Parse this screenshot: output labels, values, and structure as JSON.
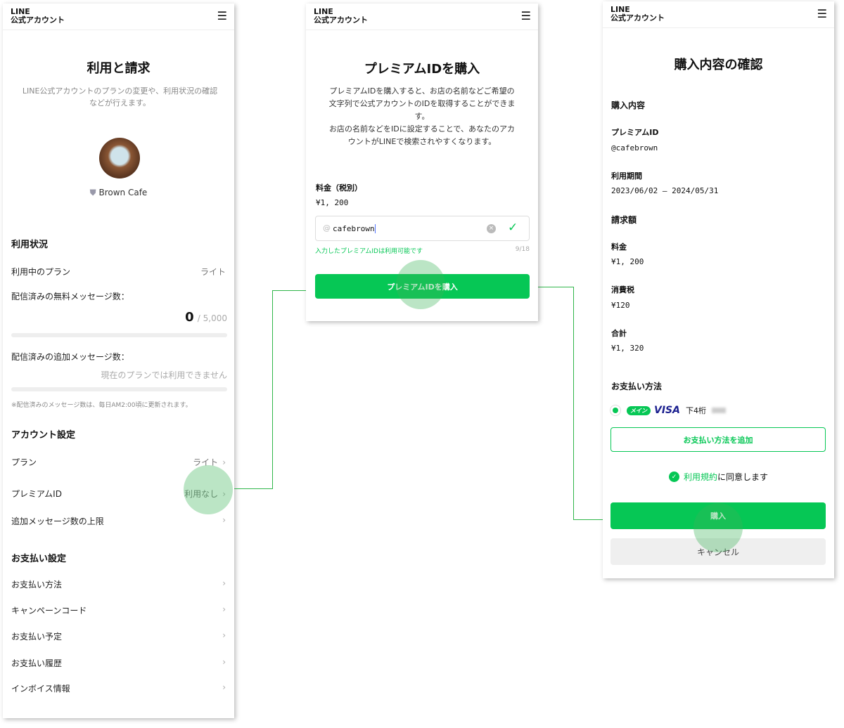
{
  "brand": {
    "logo_line1": "LINE",
    "logo_line2": "公式アカウント",
    "accent": "#06c755"
  },
  "screen1": {
    "title": "利用と請求",
    "description": "LINE公式アカウントのプランの変更や、利用状況の確認などが行えます。",
    "account_name": "Brown Cafe",
    "usage_heading": "利用状況",
    "plan_label": "利用中のプラン",
    "plan_value": "ライト",
    "free_msg_label": "配信済みの無料メッセージ数：",
    "free_msg_count": "0",
    "free_msg_limit": "/ 5,000",
    "free_msg_progress": 0,
    "extra_msg_label": "配信済みの追加メッセージ数：",
    "extra_msg_value": "現在のプランでは利用できません",
    "note": "※配信済みのメッセージ数は、毎日AM2:00頃に更新されます。",
    "account_heading": "アカウント設定",
    "account_items": [
      {
        "label": "プラン",
        "value": "ライト"
      },
      {
        "label": "プレミアムID",
        "value": "利用なし"
      },
      {
        "label": "追加メッセージ数の上限",
        "value": ""
      }
    ],
    "payment_heading": "お支払い設定",
    "payment_items": [
      {
        "label": "お支払い方法"
      },
      {
        "label": "キャンペーンコード"
      },
      {
        "label": "お支払い予定"
      },
      {
        "label": "お支払い履歴"
      },
      {
        "label": "インボイス情報"
      }
    ]
  },
  "screen2": {
    "title": "プレミアムIDを購入",
    "description1": "プレミアムIDを購入すると、お店の名前などご希望の文字列で公式アカウントのIDを取得することができます。",
    "description2": "お店の名前などをIDに設定することで、あなたのアカウントがLINEで検索されやすくなります。",
    "price_label": "料金（税別）",
    "price_value": "¥1, 200",
    "id_prefix": "@",
    "id_value": "cafebrown",
    "available_msg": "入力したプレミアムIDは利用可能です",
    "char_count": "9/18",
    "buy_button": "プレミアムIDを購入"
  },
  "screen3": {
    "title": "購入内容の確認",
    "purchase_heading": "購入内容",
    "premium_id_label": "プレミアムID",
    "premium_id_value": "@cafebrown",
    "period_label": "利用期間",
    "period_value": "2023/06/02 – 2024/05/31",
    "billing_heading": "請求額",
    "fee_label": "料金",
    "fee_value": "¥1, 200",
    "tax_label": "消費税",
    "tax_value": "¥120",
    "total_label": "合計",
    "total_value": "¥1, 320",
    "payment_heading": "お支払い方法",
    "main_badge": "メイン",
    "card_brand": "VISA",
    "last4_label": "下4桁",
    "add_payment_button": "お支払い方法を追加",
    "terms_link": "利用規約",
    "terms_text": "に同意します",
    "buy_button": "購入",
    "cancel_button": "キャンセル"
  }
}
